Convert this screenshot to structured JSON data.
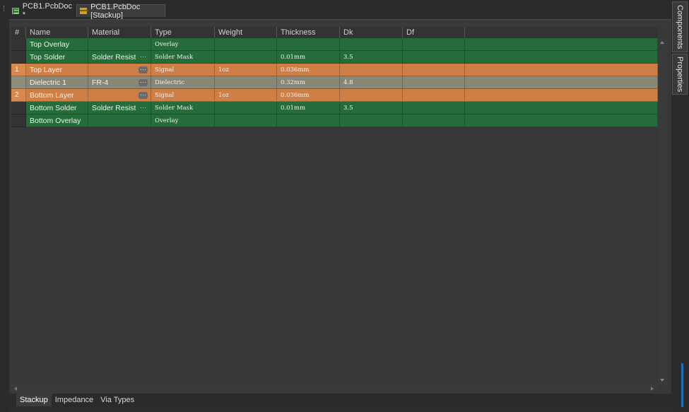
{
  "tabs": [
    {
      "label": "PCB1.PcbDoc *"
    },
    {
      "label": "PCB1.PcbDoc [Stackup]"
    }
  ],
  "columns": [
    "#",
    "Name",
    "Material",
    "Type",
    "Weight",
    "Thickness",
    "Dk",
    "Df"
  ],
  "rows": [
    {
      "num": "",
      "name": "Top Overlay",
      "material": "",
      "type": "Overlay",
      "weight": "",
      "thickness": "",
      "dk": "",
      "df": ""
    },
    {
      "num": "",
      "name": "Top Solder",
      "material": "Solder Resist",
      "type": "Solder Mask",
      "weight": "",
      "thickness": "0.01mm",
      "dk": "3.5",
      "df": ""
    },
    {
      "num": "1",
      "name": "Top Layer",
      "material": "",
      "type": "Signal",
      "weight": "1oz",
      "thickness": "0.036mm",
      "dk": "",
      "df": ""
    },
    {
      "num": "",
      "name": "Dielectric 1",
      "material": "FR-4",
      "type": "Dielectric",
      "weight": "",
      "thickness": "0.32mm",
      "dk": "4.8",
      "df": ""
    },
    {
      "num": "2",
      "name": "Bottom Layer",
      "material": "",
      "type": "Signal",
      "weight": "1oz",
      "thickness": "0.036mm",
      "dk": "",
      "df": ""
    },
    {
      "num": "",
      "name": "Bottom Solder",
      "material": "Solder Resist",
      "type": "Solder Mask",
      "weight": "",
      "thickness": "0.01mm",
      "dk": "3.5",
      "df": ""
    },
    {
      "num": "",
      "name": "Bottom Overlay",
      "material": "",
      "type": "Overlay",
      "weight": "",
      "thickness": "",
      "dk": "",
      "df": ""
    }
  ],
  "ellipsis": "···",
  "bottom_tabs": [
    "Stackup",
    "Impedance",
    "Via Types"
  ],
  "side_panels": [
    "Components",
    "Properties"
  ],
  "colors": {
    "overlay_solder": "#256c3a",
    "signal": "#cf7f45",
    "dielectric": "#8a8675",
    "selection": "#7fc8f5"
  }
}
